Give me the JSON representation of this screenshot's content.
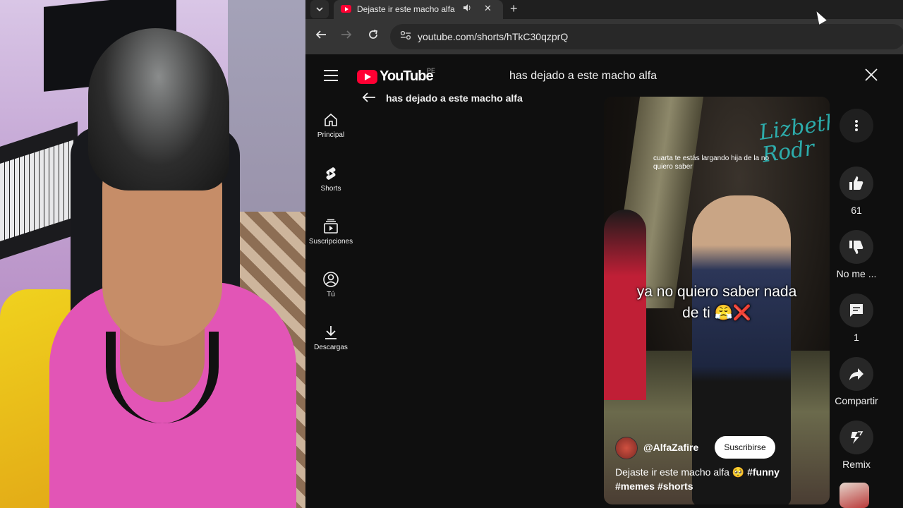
{
  "browser": {
    "tab": {
      "title": "Dejaste ir este macho alfa",
      "speaker_icon": "speaker-icon",
      "close": "✕"
    },
    "new_tab": "+",
    "url": "youtube.com/shorts/hTkC30qzprQ"
  },
  "youtube": {
    "logo_text": "YouTube",
    "country_code": "PE",
    "search_query": "has dejado a este macho alfa",
    "search_suggestion": "has dejado a este macho alfa",
    "guide": [
      {
        "label": "Principal",
        "icon": "home-icon"
      },
      {
        "label": "Shorts",
        "icon": "shorts-icon"
      },
      {
        "label": "Suscripciones",
        "icon": "subscriptions-icon"
      },
      {
        "label": "Tú",
        "icon": "user-icon"
      },
      {
        "label": "Descargas",
        "icon": "download-icon"
      }
    ],
    "short": {
      "caption_top": "cuarta te estás largando hija de la no quiero saber",
      "overlay_line1": "ya no quiero saber nada",
      "overlay_line2": "de ti 😤❌",
      "watermark": "Lizbeth Rodr",
      "channel": "@AlfaZafire",
      "subscribe": "Suscribirse",
      "title_text": "Dejaste ir este macho alfa 🥺 ",
      "tag1": "#funny",
      "tag2": "#memes",
      "tag3": "#shorts"
    },
    "actions": {
      "likes": "61",
      "dislike": "No me ...",
      "comments": "1",
      "share": "Compartir",
      "remix": "Remix"
    }
  },
  "colors": {
    "brand_red": "#ff0033",
    "background": "#0f0f0f",
    "button_bg": "#272727"
  }
}
